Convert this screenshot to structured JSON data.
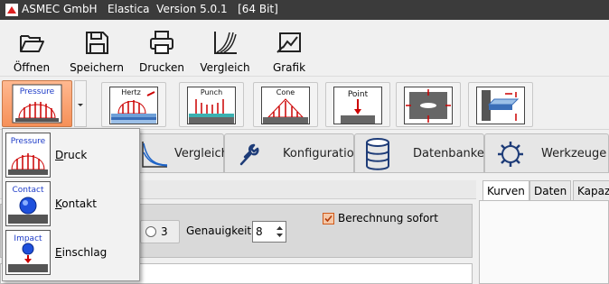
{
  "window": {
    "title": "ASMEC GmbH   Elastica  Version 5.0.1   [64 Bit]"
  },
  "toolbar": {
    "open": "Öffnen",
    "save": "Speichern",
    "print": "Drucken",
    "compare": "Vergleich",
    "graphic": "Grafik"
  },
  "models": {
    "pressure": "Pressure",
    "hertz": "Hertz",
    "punch": "Punch",
    "cone": "Cone",
    "point": "Point"
  },
  "navtabs": {
    "compare": "Vergleich",
    "config": "Konfiguration",
    "databases": "Datenbanken",
    "tools": "Werkzeuge"
  },
  "options": {
    "radio_value": "3",
    "accuracy_label": "Genauigkeit",
    "accuracy_value": "8",
    "calc_immediately": "Berechnung sofort",
    "calc_checked": true
  },
  "right_tabs": [
    "Kurven",
    "Daten",
    "Kapaz"
  ],
  "dropdown": {
    "items": [
      {
        "icon_label": "Pressure",
        "label_first": "D",
        "label_rest": "ruck"
      },
      {
        "icon_label": "Contact",
        "label_first": "K",
        "label_rest": "ontakt"
      },
      {
        "icon_label": "Impact",
        "label_first": "E",
        "label_rest": "inschlag"
      }
    ]
  },
  "colors": {
    "accent": "#f69058",
    "titlebar": "#3b3b3b"
  }
}
